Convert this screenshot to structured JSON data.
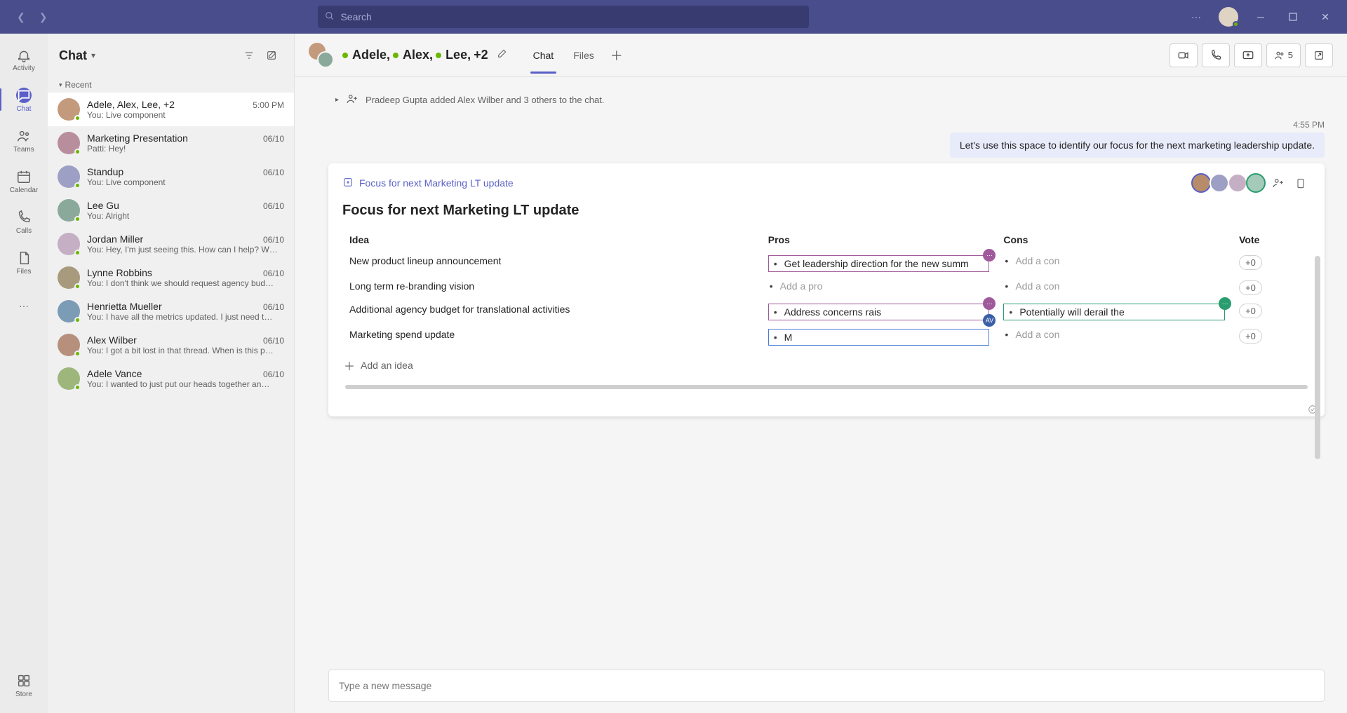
{
  "search": {
    "placeholder": "Search"
  },
  "rail": {
    "activity": "Activity",
    "chat": "Chat",
    "teams": "Teams",
    "calendar": "Calendar",
    "calls": "Calls",
    "files": "Files",
    "store": "Store"
  },
  "chatList": {
    "title": "Chat",
    "recentLabel": "Recent",
    "items": [
      {
        "name": "Adele, Alex, Lee, +2",
        "time": "5:00 PM",
        "preview": "You: Live component"
      },
      {
        "name": "Marketing Presentation",
        "time": "06/10",
        "preview": "Patti: Hey!"
      },
      {
        "name": "Standup",
        "time": "06/10",
        "preview": "You: Live component"
      },
      {
        "name": "Lee Gu",
        "time": "06/10",
        "preview": "You: Alright"
      },
      {
        "name": "Jordan Miller",
        "time": "06/10",
        "preview": "You: Hey, I'm just seeing this. How can I help? W…"
      },
      {
        "name": "Lynne Robbins",
        "time": "06/10",
        "preview": "You: I don't think we should request agency bud…"
      },
      {
        "name": "Henrietta Mueller",
        "time": "06/10",
        "preview": "You: I have all the metrics updated. I just need t…"
      },
      {
        "name": "Alex Wilber",
        "time": "06/10",
        "preview": "You: I got a bit lost in that thread. When is this p…"
      },
      {
        "name": "Adele Vance",
        "time": "06/10",
        "preview": "You: I wanted to just put our heads together an…"
      }
    ]
  },
  "chatHeader": {
    "participants": [
      "Adele,",
      "Alex,",
      "Lee,",
      "+2"
    ],
    "tabs": {
      "chat": "Chat",
      "files": "Files"
    },
    "participantCount": "5"
  },
  "systemMessage": "Pradeep Gupta added Alex Wilber and 3 others to the chat.",
  "ownMessage": {
    "time": "4:55 PM",
    "text": "Let's use this space to identify our focus for the next marketing leadership update."
  },
  "liveComponent": {
    "breadcrumb": "Focus for next Marketing LT update",
    "title": "Focus for next Marketing LT update",
    "columns": {
      "idea": "Idea",
      "pros": "Pros",
      "cons": "Cons",
      "vote": "Vote"
    },
    "placeholders": {
      "addPro": "Add a pro",
      "addCon": "Add a con",
      "addIdea": "Add an idea"
    },
    "vote": "+0",
    "rows": [
      {
        "idea": "New product lineup announcement",
        "pro": "Get leadership direction for the new summ",
        "con": ""
      },
      {
        "idea": "Long term re-branding vision",
        "pro": "",
        "con": ""
      },
      {
        "idea": "Additional agency budget for translational activities",
        "pro": "Address concerns rais",
        "con": "Potentially will derail the"
      },
      {
        "idea": "Marketing spend update",
        "pro": "M",
        "con": ""
      }
    ]
  },
  "composer": {
    "placeholder": "Type a new message"
  }
}
